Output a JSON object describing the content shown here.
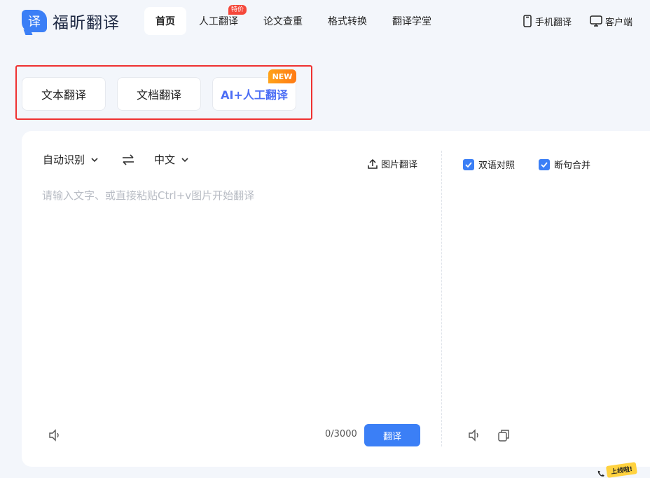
{
  "logo": {
    "mark": "译",
    "text": "福昕翻译"
  },
  "nav": [
    {
      "label": "首页",
      "active": true
    },
    {
      "label": "人工翻译",
      "badge": "特价"
    },
    {
      "label": "论文查重"
    },
    {
      "label": "格式转换"
    },
    {
      "label": "翻译学堂"
    }
  ],
  "header_right": {
    "mobile": "手机翻译",
    "client": "客户端"
  },
  "modes": {
    "text": "文本翻译",
    "document": "文档翻译",
    "ai_human": "AI+人工翻译",
    "new_tag": "NEW"
  },
  "source": {
    "lang": "自动识别",
    "target_lang": "中文",
    "image_translate": "图片翻译",
    "placeholder": "请输入文字、或直接粘贴Ctrl+v图片开始翻译",
    "value": "",
    "counter": "0/3000",
    "translate_button": "翻译"
  },
  "options": {
    "bilingual": "双语对照",
    "merge_sentences": "断句合并"
  },
  "online_tag": "上线啦!",
  "colors": {
    "accent": "#3b7ff6",
    "highlight_border": "#ef3131",
    "new_tag": "#ff8c1a"
  }
}
